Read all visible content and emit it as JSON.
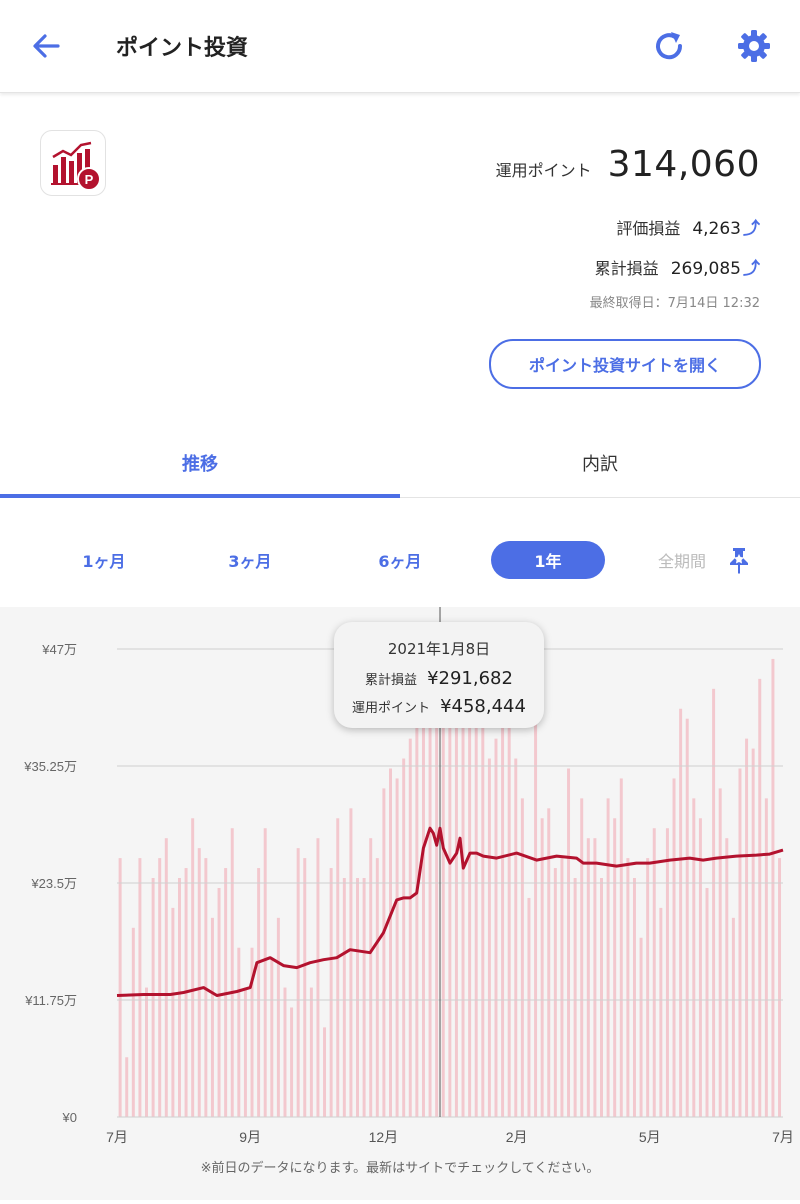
{
  "header": {
    "title": "ポイント投資",
    "back_icon": "arrow-left-icon",
    "refresh_icon": "refresh-icon",
    "settings_icon": "gear-icon",
    "accent_color": "#4c6ee5"
  },
  "summary": {
    "app_icon": "point-investment-app-icon",
    "operating_points_label": "運用ポイント",
    "operating_points_value": "314,060",
    "valuation_pl_label": "評価損益",
    "valuation_pl_value": "4,263",
    "cumulative_pl_label": "累計損益",
    "cumulative_pl_value": "269,085",
    "trend_arrow": "⤴",
    "last_updated": "最終取得日：7月14日 12:32",
    "open_site_button": "ポイント投資サイトを開く"
  },
  "tabs": [
    {
      "label": "推移",
      "active": true
    },
    {
      "label": "内訳",
      "active": false
    }
  ],
  "periods": [
    {
      "label": "1ヶ月",
      "state": "normal"
    },
    {
      "label": "3ヶ月",
      "state": "normal"
    },
    {
      "label": "6ヶ月",
      "state": "normal"
    },
    {
      "label": "1年",
      "state": "selected"
    },
    {
      "label": "全期間",
      "state": "disabled"
    }
  ],
  "pin_icon": "pin-icon",
  "tooltip": {
    "date": "2021年1月8日",
    "cumulative_label": "累計損益",
    "cumulative_value": "¥291,682",
    "points_label": "運用ポイント",
    "points_value": "¥458,444"
  },
  "chart_data": {
    "type": "line",
    "y_tick_labels": [
      "¥0",
      "¥11.75万",
      "¥23.5万",
      "¥35.25万",
      "¥47万"
    ],
    "y_ticks": [
      0,
      11.75,
      23.5,
      35.25,
      47
    ],
    "ylim": [
      0,
      47
    ],
    "x_tick_labels": [
      "7月",
      "9月",
      "12月",
      "2月",
      "5月",
      "7月"
    ],
    "x_ticks": [
      0,
      2,
      4,
      6,
      8,
      10
    ],
    "xlim": [
      0,
      10
    ],
    "highlight_x": 4.85,
    "line_color": "#b3122e",
    "bar_color": "#f2b8c0",
    "series": [
      {
        "values_kind": "line",
        "x": [
          0,
          0.4,
          0.8,
          1.0,
          1.3,
          1.5,
          1.8,
          2.0,
          2.1,
          2.3,
          2.5,
          2.7,
          2.9,
          3.1,
          3.3,
          3.5,
          3.8,
          4.0,
          4.2,
          4.3,
          4.4,
          4.5,
          4.6,
          4.7,
          4.75,
          4.8,
          4.85,
          4.9,
          5.0,
          5.1,
          5.15,
          5.2,
          5.3,
          5.4,
          5.5,
          5.7,
          6.0,
          6.3,
          6.6,
          6.9,
          7.0,
          7.2,
          7.5,
          7.8,
          8.0,
          8.3,
          8.6,
          8.8,
          9.0,
          9.3,
          9.6,
          9.8,
          10.0
        ],
        "values": [
          12.2,
          12.3,
          12.3,
          12.5,
          13.0,
          12.2,
          12.6,
          13.0,
          15.5,
          16.0,
          15.2,
          15.0,
          15.5,
          15.8,
          16.0,
          16.8,
          16.5,
          18.5,
          21.8,
          22.0,
          22.0,
          22.5,
          27.0,
          29.0,
          28.5,
          27.3,
          29.0,
          27.0,
          25.5,
          26.5,
          28.0,
          25.0,
          26.5,
          26.5,
          26.2,
          26.0,
          26.5,
          25.8,
          26.2,
          26.0,
          25.5,
          25.5,
          25.2,
          25.5,
          25.5,
          25.8,
          26.0,
          25.8,
          26.0,
          26.2,
          26.3,
          26.4,
          26.8
        ]
      },
      {
        "values_kind": "bars",
        "values": [
          26,
          6,
          19,
          26,
          13,
          24,
          26,
          28,
          21,
          24,
          25,
          30,
          27,
          26,
          20,
          23,
          25,
          29,
          17,
          13,
          17,
          25,
          29,
          16,
          20,
          13,
          11,
          27,
          26,
          13,
          28,
          9,
          25,
          30,
          24,
          31,
          24,
          24,
          28,
          26,
          33,
          35,
          34,
          36,
          38,
          40,
          42,
          47,
          47,
          47,
          47,
          45,
          45,
          46,
          46,
          43,
          36,
          38,
          44,
          40,
          36,
          32,
          22,
          41,
          30,
          31,
          25,
          26,
          35,
          24,
          32,
          28,
          28,
          24,
          32,
          30,
          34,
          26,
          24,
          18,
          26,
          29,
          21,
          29,
          34,
          41,
          40,
          32,
          30,
          23,
          43,
          33,
          28,
          20,
          35,
          38,
          37,
          44,
          32,
          46,
          26
        ]
      }
    ]
  },
  "footnote": "※前日のデータになります。最新はサイトでチェックしてください。"
}
